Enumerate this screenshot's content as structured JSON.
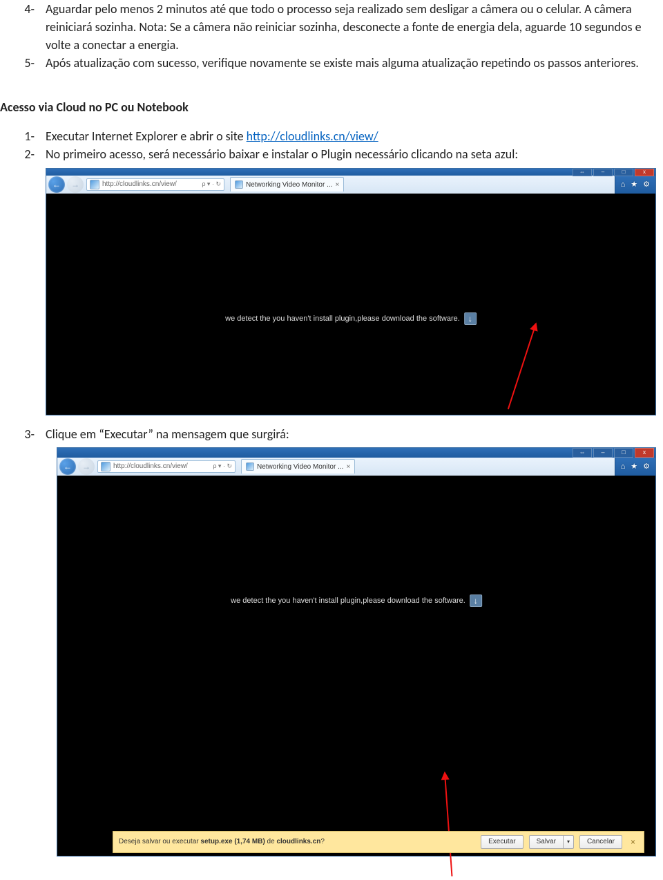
{
  "steps_top": [
    {
      "num": "4-",
      "text": "Aguardar pelo menos 2 minutos até que todo o processo seja realizado sem desligar a câmera ou o celular. A câmera reiniciará sozinha. Nota: Se a câmera não reiniciar sozinha, desconecte a fonte de energia dela, aguarde 10 segundos e volte a conectar a energia."
    },
    {
      "num": "5-",
      "text": "Após atualização com sucesso, verifique novamente se existe mais alguma atualização repetindo os passos anteriores."
    }
  ],
  "section_heading": "Acesso via Cloud no PC ou Notebook",
  "ol": {
    "item1": {
      "num": "1-",
      "prefix": "Executar Internet Explorer e abrir o site ",
      "link_text": "http://cloudlinks.cn/view/"
    },
    "item2": {
      "num": "2-",
      "text": "No primeiro acesso, será necessário baixar e instalar o Plugin necessário clicando na seta azul:"
    },
    "item3": {
      "num": "3-",
      "text": "Clique em “Executar” na mensagem que surgirá:"
    }
  },
  "ie": {
    "window_buttons": {
      "separate": "⇔",
      "min": "–",
      "max": "□",
      "close": "x"
    },
    "nav_back": "←",
    "nav_fwd": "→",
    "url": "http://cloudlinks.cn/view/",
    "addr_search": "ρ ▾ · ↻",
    "tab_title": "Networking Video Monitor ...",
    "tab_close": "×",
    "right_home": "⌂",
    "right_star": "★",
    "right_gear": "⚙",
    "plugin_msg": "we detect the you haven't install plugin,please download the software.",
    "dl_arrow": "↓"
  },
  "dlbar": {
    "prefix": "Deseja salvar ou executar ",
    "file": "setup.exe (1,74 MB)",
    "mid": " de ",
    "host": "cloudlinks.cn",
    "q": "?",
    "btn_exec": "Executar",
    "btn_save": "Salvar",
    "caret": "▾",
    "btn_cancel": "Cancelar",
    "close": "×"
  }
}
